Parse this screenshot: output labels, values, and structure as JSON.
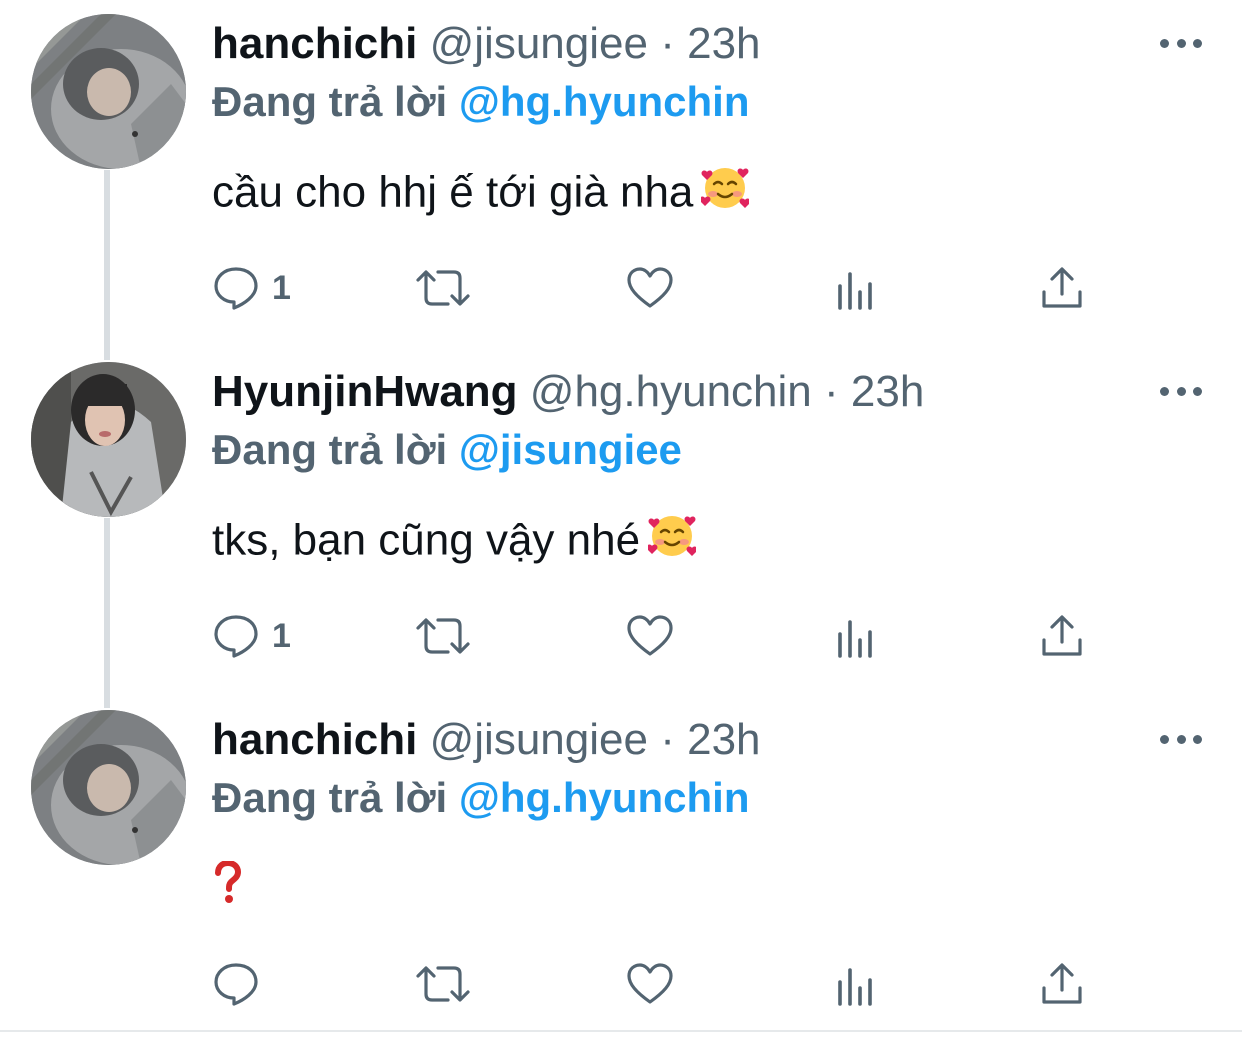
{
  "tweets": [
    {
      "display_name": "hanchichi",
      "handle": "@jisungiee",
      "separator": "·",
      "time": "23h",
      "reply_prefix": "Đang trả lời",
      "reply_to": "@hg.hyunchin",
      "text": "cầu cho hhj ế tới già nha",
      "emoji": "smiling-face-with-hearts-icon",
      "reply_count": "1",
      "avatar": "avatar-gray-hoodie"
    },
    {
      "display_name": "HyunjinHwang",
      "handle": "@hg.hyunchin",
      "separator": "·",
      "time": "23h",
      "reply_prefix": "Đang trả lời",
      "reply_to": "@jisungiee",
      "text": "tks, bạn cũng vậy nhé",
      "emoji": "smiling-face-with-hearts-icon",
      "reply_count": "1",
      "avatar": "avatar-hooded-person"
    },
    {
      "display_name": "hanchichi",
      "handle": "@jisungiee",
      "separator": "·",
      "time": "23h",
      "reply_prefix": "Đang trả lời",
      "reply_to": "@hg.hyunchin",
      "text": "",
      "emoji": "question-mark-icon",
      "reply_count": "",
      "avatar": "avatar-gray-hoodie"
    }
  ],
  "icons": {
    "reply": "reply-icon",
    "retweet": "retweet-icon",
    "like": "heart-icon",
    "views": "views-chart-icon",
    "share": "share-icon",
    "more": "more-dots-icon"
  },
  "colors": {
    "text": "#0f1419",
    "secondary": "#536471",
    "link": "#1d9bf0",
    "thread_line": "#d8dde1"
  }
}
